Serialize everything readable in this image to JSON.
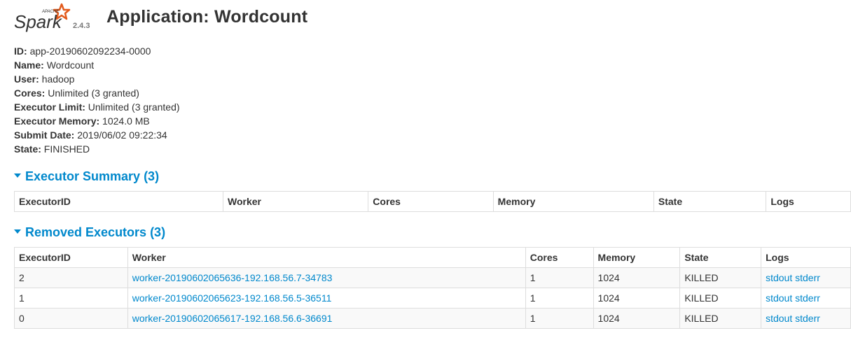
{
  "header": {
    "logo_text": "Spark",
    "logo_sub": "APACHE",
    "version": "2.4.3",
    "title": "Application: Wordcount"
  },
  "info": [
    {
      "label": "ID:",
      "value": "app-20190602092234-0000"
    },
    {
      "label": "Name:",
      "value": "Wordcount"
    },
    {
      "label": "User:",
      "value": "hadoop"
    },
    {
      "label": "Cores:",
      "value": "Unlimited (3 granted)"
    },
    {
      "label": "Executor Limit:",
      "value": "Unlimited (3 granted)"
    },
    {
      "label": "Executor Memory:",
      "value": "1024.0 MB"
    },
    {
      "label": "Submit Date:",
      "value": "2019/06/02 09:22:34"
    },
    {
      "label": "State:",
      "value": "FINISHED"
    }
  ],
  "executor_summary": {
    "title": "Executor Summary (3)",
    "columns": [
      "ExecutorID",
      "Worker",
      "Cores",
      "Memory",
      "State",
      "Logs"
    ]
  },
  "removed_executors": {
    "title": "Removed Executors (3)",
    "columns": [
      "ExecutorID",
      "Worker",
      "Cores",
      "Memory",
      "State",
      "Logs"
    ],
    "rows": [
      {
        "id": "2",
        "worker": "worker-20190602065636-192.168.56.7-34783",
        "cores": "1",
        "memory": "1024",
        "state": "KILLED",
        "stdout": "stdout",
        "stderr": "stderr"
      },
      {
        "id": "1",
        "worker": "worker-20190602065623-192.168.56.5-36511",
        "cores": "1",
        "memory": "1024",
        "state": "KILLED",
        "stdout": "stdout",
        "stderr": "stderr"
      },
      {
        "id": "0",
        "worker": "worker-20190602065617-192.168.56.6-36691",
        "cores": "1",
        "memory": "1024",
        "state": "KILLED",
        "stdout": "stdout",
        "stderr": "stderr"
      }
    ]
  },
  "colors": {
    "link": "#0088cc",
    "logo_orange": "#e25a1c",
    "text": "#333333"
  }
}
